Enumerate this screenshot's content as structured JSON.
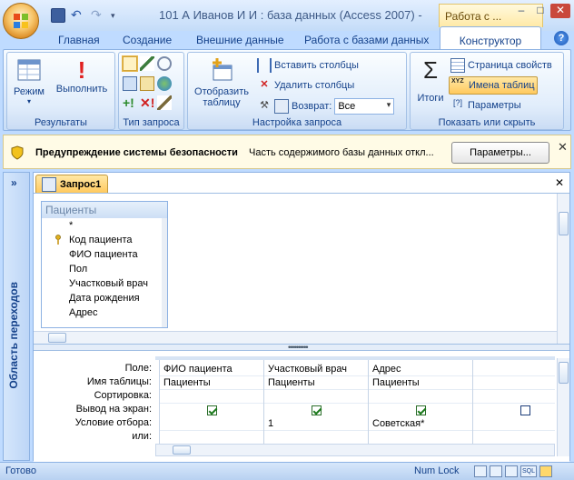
{
  "window": {
    "title": "101 А Иванов И И : база данных (Access 2007) -",
    "context_tab": "Работа с ...",
    "min": "–",
    "max": "□",
    "close": "✕"
  },
  "tabs": [
    "Главная",
    "Создание",
    "Внешние данные",
    "Работа с базами данных",
    "Конструктор"
  ],
  "ribbon": {
    "results": {
      "title": "Результаты",
      "mode": "Режим",
      "run": "Выполнить"
    },
    "query_type": {
      "title": "Тип запроса"
    },
    "setup": {
      "title": "Настройка запроса",
      "show_table": "Отобразить таблицу",
      "insert_cols": "Вставить столбцы",
      "delete_cols": "Удалить столбцы",
      "return_label": "Возврат:",
      "return_value": "Все"
    },
    "show_hide": {
      "title": "Показать или скрыть",
      "totals": "Итоги",
      "props": "Страница свойств",
      "table_names": "Имена таблиц",
      "params": "Параметры"
    }
  },
  "security": {
    "title": "Предупреждение системы безопасности",
    "message": "Часть содержимого базы данных откл...",
    "button": "Параметры..."
  },
  "nav": {
    "label": "Область переходов",
    "chevron": "»"
  },
  "doc": {
    "tab": "Запрос1",
    "close": "✕"
  },
  "table": {
    "name": "Пациенты",
    "fields": [
      "*",
      "Код пациента",
      "ФИО пациента",
      "Пол",
      "Участковый врач",
      "Дата рождения",
      "Адрес"
    ]
  },
  "grid": {
    "row_labels": [
      "Поле:",
      "Имя таблицы:",
      "Сортировка:",
      "Вывод на экран:",
      "Условие отбора:",
      "или:"
    ],
    "columns": [
      {
        "field": "ФИО пациента",
        "table": "Пациенты",
        "sort": "",
        "show": true,
        "criteria": "",
        "or": ""
      },
      {
        "field": "Участковый врач",
        "table": "Пациенты",
        "sort": "",
        "show": true,
        "criteria": "1",
        "or": ""
      },
      {
        "field": "Адрес",
        "table": "Пациенты",
        "sort": "",
        "show": true,
        "criteria": "Советская*",
        "or": ""
      },
      {
        "field": "",
        "table": "",
        "sort": "",
        "show": false,
        "criteria": "",
        "or": ""
      }
    ]
  },
  "status": {
    "ready": "Готово",
    "numlock": "Num Lock",
    "sql": "SQL"
  }
}
